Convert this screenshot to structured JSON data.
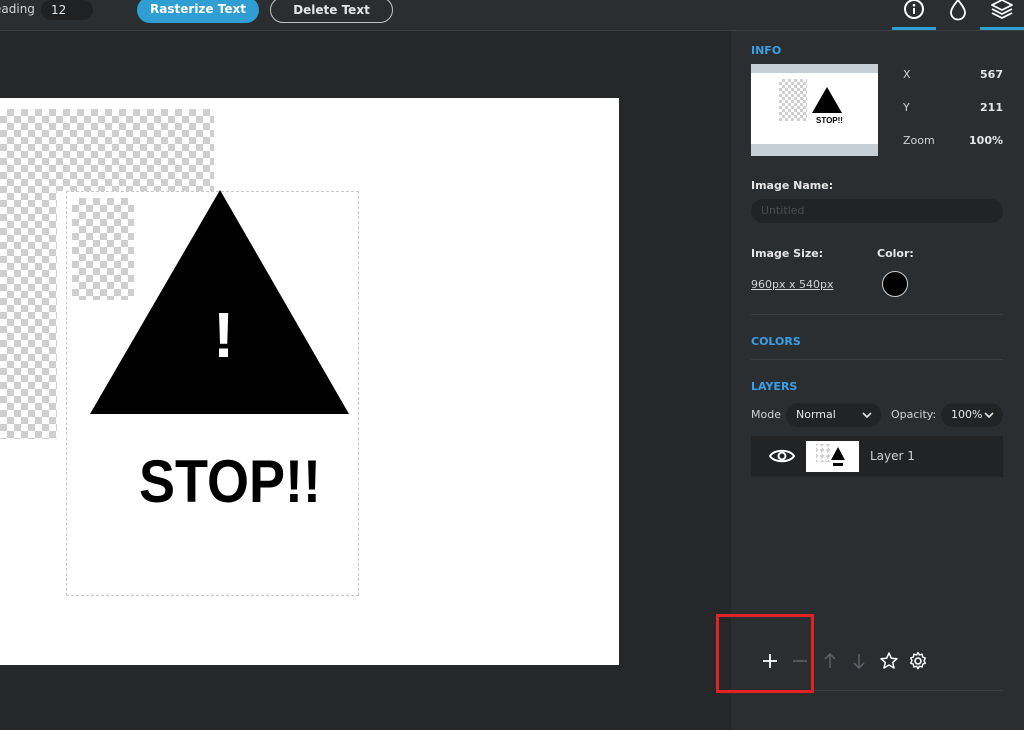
{
  "toolbar": {
    "leading_label": "eading",
    "leading_value": "12",
    "rasterize_label": "Rasterize Text",
    "delete_label": "Delete Text"
  },
  "canvas": {
    "stop_text": "STOP!!",
    "exclamation": "!"
  },
  "panel": {
    "info_title": "INFO",
    "info": {
      "x_label": "X",
      "x_value": "567",
      "y_label": "Y",
      "y_value": "211",
      "zoom_label": "Zoom",
      "zoom_value": "100%"
    },
    "image_name_label": "Image Name:",
    "image_name_placeholder": "Untitled",
    "image_size_label": "Image Size:",
    "image_size_value": "960px x 540px",
    "color_label": "Color:",
    "colors_title": "COLORS",
    "layers_title": "LAYERS",
    "mode_label": "Mode",
    "mode_value": "Normal",
    "opacity_label": "Opacity:",
    "opacity_value": "100%",
    "layers": [
      {
        "name": "Layer 1"
      }
    ]
  },
  "colors": {
    "accent": "#2f9fd3",
    "panel_bg": "#2b2e31",
    "highlight": "#e32226"
  }
}
